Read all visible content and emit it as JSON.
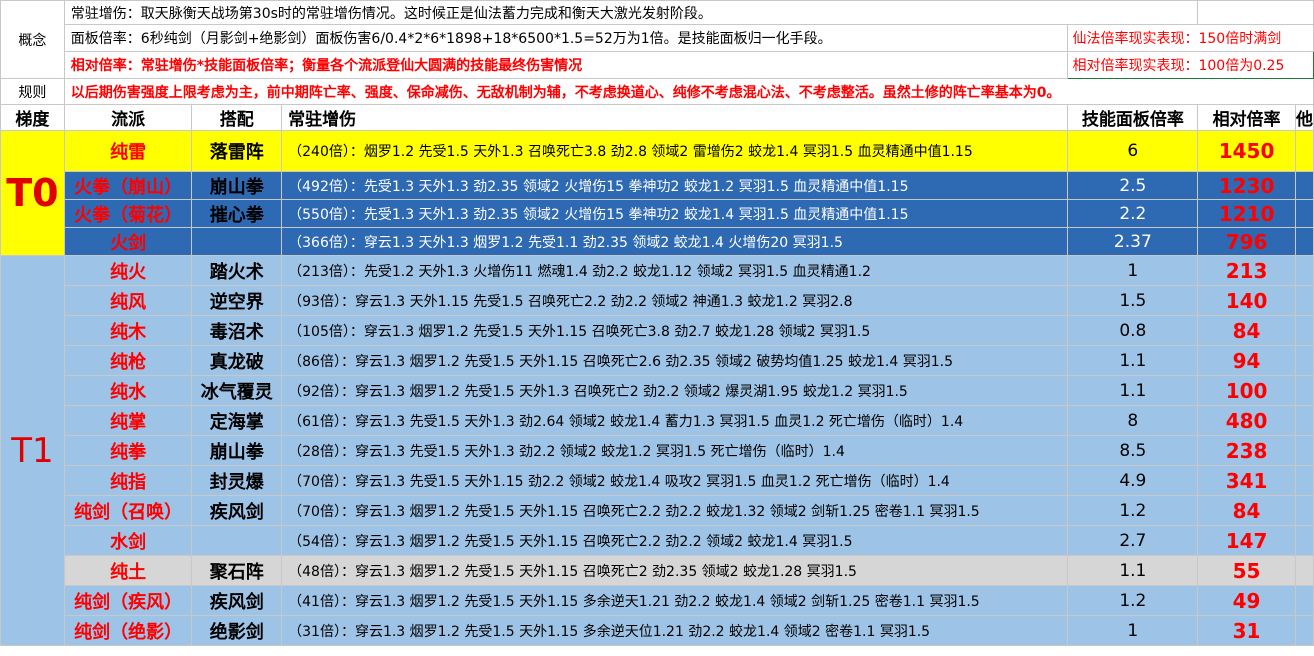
{
  "concept": {
    "label": "概念",
    "line1": "常驻增伤：取天脉衡天战场第30s时的常驻增伤情况。这时候正是仙法蓄力完成和衡天大激光发射阶段。",
    "line2": "面板倍率：6秒纯剑（月影剑+绝影剑）面板伤害6/0.4*2*6*1898+18*6500*1.5=52万为1倍。是技能面板归一化手段。",
    "line3": "相对倍率：常驻增伤*技能面板倍率；衡量各个流派登仙大圆满的技能最终伤害情况",
    "note1": "仙法倍率现实表现：150倍时满剑",
    "note2": "相对倍率现实表现：100倍为0.25"
  },
  "rules": {
    "label": "规则",
    "text": "以后期伤害强度上限考虑为主，前中期阵亡率、强度、保命减伤、无敌机制为辅，不考虑换道心、纯修不考虑混心法、不考虑整活。虽然土修的阵亡率基本为0。"
  },
  "headers": {
    "tier": "梯度",
    "sect": "流派",
    "combo": "搭配",
    "buff": "常驻增伤",
    "skill": "技能面板倍率",
    "relative": "相对倍率",
    "extra": "他"
  },
  "tiers": {
    "t0": "T0",
    "t1": "T1"
  },
  "rows": [
    {
      "sect": "纯雷",
      "combo": "落雷阵",
      "desc": "（240倍）：烟罗1.2 先受1.5 天外1.3 召唤死亡3.8 劲2.8 领域2 雷增伤2 蛟龙1.4 冥羽1.5 血灵精通中值1.15",
      "skill": "6",
      "rel": "1450"
    },
    {
      "sect": "火拳（崩山）",
      "combo": "崩山拳",
      "desc": "（492倍）：先受1.3 天外1.3  劲2.35 领域2 火增伤15 拳神功2 蛟龙1.2 冥羽1.5 血灵精通中值1.15",
      "skill": "2.5",
      "rel": "1230"
    },
    {
      "sect": "火拳（菊花）",
      "combo": "摧心拳",
      "desc": "（550倍）：先受1.3 天外1.3  劲2.35 领域2 火增伤15 拳神功2 蛟龙1.4 冥羽1.5 血灵精通中值1.15",
      "skill": "2.2",
      "rel": "1210"
    },
    {
      "sect": "火剑",
      "combo": "",
      "desc": "（366倍）：穿云1.3 天外1.3 烟罗1.2 先受1.1  劲2.35 领域2  蛟龙1.4 火增伤20 冥羽1.5",
      "skill": "2.37",
      "rel": "796"
    },
    {
      "sect": "纯火",
      "combo": "踏火术",
      "desc": "（213倍）：先受1.2 天外1.3 火增伤11 燃魂1.4 劲2.2 蛟龙1.12 领域2 冥羽1.5 血灵精通1.2",
      "skill": "1",
      "rel": "213"
    },
    {
      "sect": "纯风",
      "combo": "逆空界",
      "desc": "（93倍）：穿云1.3 天外1.15 先受1.5 召唤死亡2.2 劲2.2 领域2 神通1.3 蛟龙1.2 冥羽2.8",
      "skill": "1.5",
      "rel": "140"
    },
    {
      "sect": "纯木",
      "combo": "毒沼术",
      "desc": "（105倍）：穿云1.3 烟罗1.2 先受1.5 天外1.15 召唤死亡3.8 劲2.7 蛟龙1.28 领域2 冥羽1.5",
      "skill": "0.8",
      "rel": "84"
    },
    {
      "sect": "纯枪",
      "combo": "真龙破",
      "desc": "（86倍）：穿云1.3 烟罗1.2 先受1.5 天外1.15 召唤死亡2.6 劲2.35 领域2 破势均值1.25  蛟龙1.4 冥羽1.5",
      "skill": "1.1",
      "rel": "94"
    },
    {
      "sect": "纯水",
      "combo": "冰气覆灵",
      "desc": "（92倍）：穿云1.3 烟罗1.2 先受1.5 天外1.3 召唤死亡2 劲2.2 领域2 爆灵湖1.95 蛟龙1.2 冥羽1.5",
      "skill": "1.1",
      "rel": "100"
    },
    {
      "sect": "纯掌",
      "combo": "定海掌",
      "desc": "（61倍）：穿云1.3 先受1.5 天外1.3  劲2.64 领域2 蛟龙1.4 蓄力1.3 冥羽1.5 血灵1.2 死亡增伤（临时）1.4",
      "skill": "8",
      "rel": "480"
    },
    {
      "sect": "纯拳",
      "combo": "崩山拳",
      "desc": "（28倍）：穿云1.3 先受1.5 天外1.3  劲2.2 领域2 蛟龙1.2 冥羽1.5  死亡增伤（临时）1.4",
      "skill": "8.5",
      "rel": "238"
    },
    {
      "sect": "纯指",
      "combo": "封灵爆",
      "desc": "（70倍）：穿云1.3 先受1.5 天外1.15  劲2.2 领域2 蛟龙1.4 吸攻2 冥羽1.5 血灵1.2 死亡增伤（临时）1.4",
      "skill": "4.9",
      "rel": "341"
    },
    {
      "sect": "纯剑（召唤）",
      "combo": "疾风剑",
      "desc": "（70倍）：穿云1.3 烟罗1.2 先受1.5 天外1.15 召唤死亡2.2 劲2.2 蛟龙1.32 领域2 剑斩1.25 密卷1.1 冥羽1.5",
      "skill": "1.2",
      "rel": "84"
    },
    {
      "sect": "水剑",
      "combo": "",
      "desc": "（54倍）：穿云1.3 烟罗1.2 先受1.5 天外1.15 召唤死亡2.2 劲2.2 领域2 蛟龙1.4 冥羽1.5",
      "skill": "2.7",
      "rel": "147"
    },
    {
      "sect": "纯土",
      "combo": "聚石阵",
      "desc": "（48倍）：穿云1.3 烟罗1.2 先受1.5 天外1.15 召唤死亡2 劲2.35 领域2 蛟龙1.28 冥羽1.5",
      "skill": "1.1",
      "rel": "55"
    },
    {
      "sect": "纯剑（疾风）",
      "combo": "疾风剑",
      "desc": "（41倍）：穿云1.3 烟罗1.2 先受1.5 天外1.15 多余逆天1.21 劲2.2 蛟龙1.4 领域2 剑斩1.25 密卷1.1 冥羽1.5",
      "skill": "1.2",
      "rel": "49"
    },
    {
      "sect": "纯剑（绝影）",
      "combo": "绝影剑",
      "desc": "（31倍）：穿云1.3 烟罗1.2 先受1.5 天外1.15 多余逆天位1.21 劲2.2 蛟龙1.4 领域2 密卷1.1 冥羽1.5",
      "skill": "1",
      "rel": "31"
    }
  ]
}
